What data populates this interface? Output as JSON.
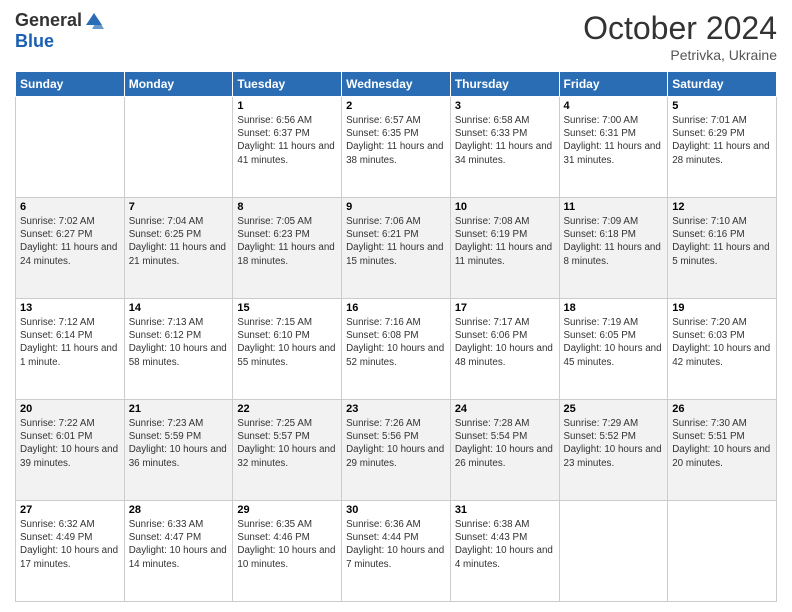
{
  "header": {
    "logo_general": "General",
    "logo_blue": "Blue",
    "month_title": "October 2024",
    "subtitle": "Petrivka, Ukraine"
  },
  "days_of_week": [
    "Sunday",
    "Monday",
    "Tuesday",
    "Wednesday",
    "Thursday",
    "Friday",
    "Saturday"
  ],
  "weeks": [
    [
      {
        "day": "",
        "info": ""
      },
      {
        "day": "",
        "info": ""
      },
      {
        "day": "1",
        "info": "Sunrise: 6:56 AM\nSunset: 6:37 PM\nDaylight: 11 hours and 41 minutes."
      },
      {
        "day": "2",
        "info": "Sunrise: 6:57 AM\nSunset: 6:35 PM\nDaylight: 11 hours and 38 minutes."
      },
      {
        "day": "3",
        "info": "Sunrise: 6:58 AM\nSunset: 6:33 PM\nDaylight: 11 hours and 34 minutes."
      },
      {
        "day": "4",
        "info": "Sunrise: 7:00 AM\nSunset: 6:31 PM\nDaylight: 11 hours and 31 minutes."
      },
      {
        "day": "5",
        "info": "Sunrise: 7:01 AM\nSunset: 6:29 PM\nDaylight: 11 hours and 28 minutes."
      }
    ],
    [
      {
        "day": "6",
        "info": "Sunrise: 7:02 AM\nSunset: 6:27 PM\nDaylight: 11 hours and 24 minutes."
      },
      {
        "day": "7",
        "info": "Sunrise: 7:04 AM\nSunset: 6:25 PM\nDaylight: 11 hours and 21 minutes."
      },
      {
        "day": "8",
        "info": "Sunrise: 7:05 AM\nSunset: 6:23 PM\nDaylight: 11 hours and 18 minutes."
      },
      {
        "day": "9",
        "info": "Sunrise: 7:06 AM\nSunset: 6:21 PM\nDaylight: 11 hours and 15 minutes."
      },
      {
        "day": "10",
        "info": "Sunrise: 7:08 AM\nSunset: 6:19 PM\nDaylight: 11 hours and 11 minutes."
      },
      {
        "day": "11",
        "info": "Sunrise: 7:09 AM\nSunset: 6:18 PM\nDaylight: 11 hours and 8 minutes."
      },
      {
        "day": "12",
        "info": "Sunrise: 7:10 AM\nSunset: 6:16 PM\nDaylight: 11 hours and 5 minutes."
      }
    ],
    [
      {
        "day": "13",
        "info": "Sunrise: 7:12 AM\nSunset: 6:14 PM\nDaylight: 11 hours and 1 minute."
      },
      {
        "day": "14",
        "info": "Sunrise: 7:13 AM\nSunset: 6:12 PM\nDaylight: 10 hours and 58 minutes."
      },
      {
        "day": "15",
        "info": "Sunrise: 7:15 AM\nSunset: 6:10 PM\nDaylight: 10 hours and 55 minutes."
      },
      {
        "day": "16",
        "info": "Sunrise: 7:16 AM\nSunset: 6:08 PM\nDaylight: 10 hours and 52 minutes."
      },
      {
        "day": "17",
        "info": "Sunrise: 7:17 AM\nSunset: 6:06 PM\nDaylight: 10 hours and 48 minutes."
      },
      {
        "day": "18",
        "info": "Sunrise: 7:19 AM\nSunset: 6:05 PM\nDaylight: 10 hours and 45 minutes."
      },
      {
        "day": "19",
        "info": "Sunrise: 7:20 AM\nSunset: 6:03 PM\nDaylight: 10 hours and 42 minutes."
      }
    ],
    [
      {
        "day": "20",
        "info": "Sunrise: 7:22 AM\nSunset: 6:01 PM\nDaylight: 10 hours and 39 minutes."
      },
      {
        "day": "21",
        "info": "Sunrise: 7:23 AM\nSunset: 5:59 PM\nDaylight: 10 hours and 36 minutes."
      },
      {
        "day": "22",
        "info": "Sunrise: 7:25 AM\nSunset: 5:57 PM\nDaylight: 10 hours and 32 minutes."
      },
      {
        "day": "23",
        "info": "Sunrise: 7:26 AM\nSunset: 5:56 PM\nDaylight: 10 hours and 29 minutes."
      },
      {
        "day": "24",
        "info": "Sunrise: 7:28 AM\nSunset: 5:54 PM\nDaylight: 10 hours and 26 minutes."
      },
      {
        "day": "25",
        "info": "Sunrise: 7:29 AM\nSunset: 5:52 PM\nDaylight: 10 hours and 23 minutes."
      },
      {
        "day": "26",
        "info": "Sunrise: 7:30 AM\nSunset: 5:51 PM\nDaylight: 10 hours and 20 minutes."
      }
    ],
    [
      {
        "day": "27",
        "info": "Sunrise: 6:32 AM\nSunset: 4:49 PM\nDaylight: 10 hours and 17 minutes."
      },
      {
        "day": "28",
        "info": "Sunrise: 6:33 AM\nSunset: 4:47 PM\nDaylight: 10 hours and 14 minutes."
      },
      {
        "day": "29",
        "info": "Sunrise: 6:35 AM\nSunset: 4:46 PM\nDaylight: 10 hours and 10 minutes."
      },
      {
        "day": "30",
        "info": "Sunrise: 6:36 AM\nSunset: 4:44 PM\nDaylight: 10 hours and 7 minutes."
      },
      {
        "day": "31",
        "info": "Sunrise: 6:38 AM\nSunset: 4:43 PM\nDaylight: 10 hours and 4 minutes."
      },
      {
        "day": "",
        "info": ""
      },
      {
        "day": "",
        "info": ""
      }
    ]
  ]
}
